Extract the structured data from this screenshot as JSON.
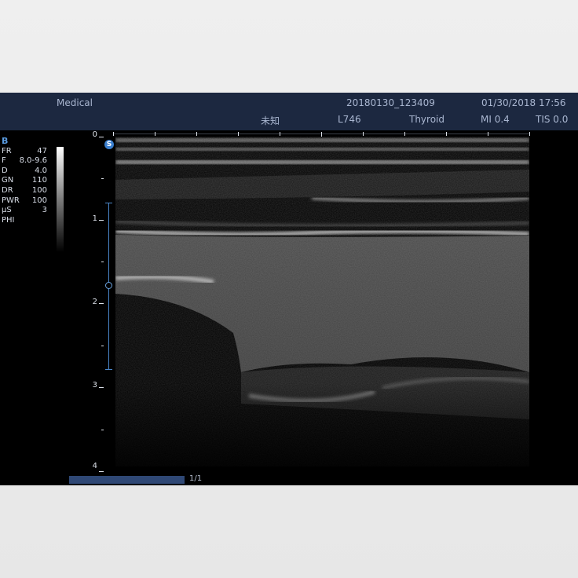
{
  "header": {
    "brand": "Medical",
    "study_id": "20180130_123409",
    "datetime": "01/30/2018 17:56",
    "patient_name": "未知",
    "probe": "L746",
    "preset": "Thyroid",
    "mi": "MI 0.4",
    "tis": "TIS 0.0"
  },
  "params": {
    "mode": "B",
    "rows": [
      {
        "label": "FR",
        "value": "47"
      },
      {
        "label": "F",
        "value": "8.0-9.6"
      },
      {
        "label": "D",
        "value": "4.0"
      },
      {
        "label": "GN",
        "value": "110"
      },
      {
        "label": "DR",
        "value": "100"
      },
      {
        "label": "PWR",
        "value": "100"
      },
      {
        "label": "μS",
        "value": "3"
      },
      {
        "label": "PHI",
        "value": ""
      }
    ]
  },
  "depth_scale": {
    "labels": [
      "0",
      "1",
      "2",
      "3",
      "4"
    ]
  },
  "orientation_marker": "S",
  "cine": {
    "frame_label": "1/1",
    "position": 1.0
  },
  "colors": {
    "header_bg": "#1c2840",
    "accent_blue": "#4a86c9",
    "text": "#a9b6d0"
  }
}
